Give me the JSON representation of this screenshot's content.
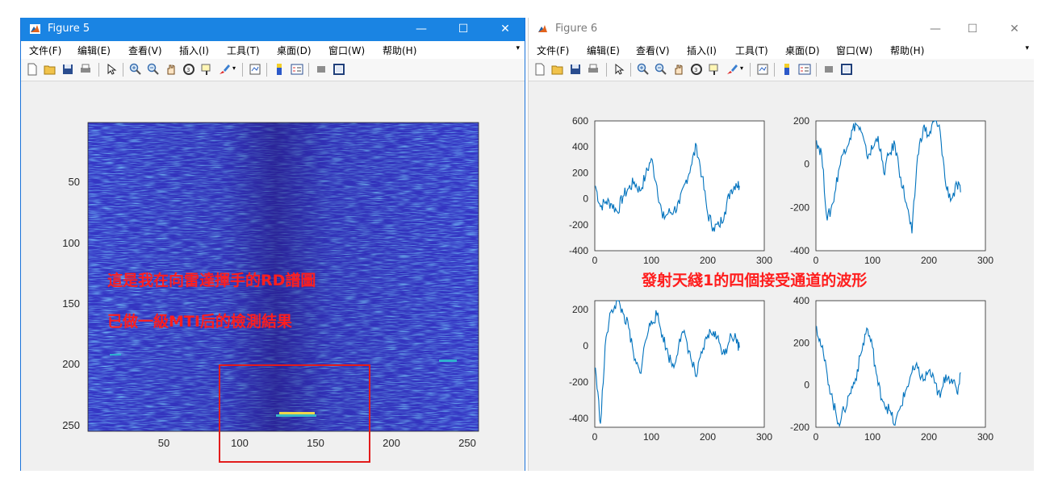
{
  "figure5": {
    "title": "Figure 5",
    "menus": [
      "文件(F)",
      "编辑(E)",
      "查看(V)",
      "插入(I)",
      "工具(T)",
      "桌面(D)",
      "窗口(W)",
      "帮助(H)"
    ],
    "controls": {
      "minimize": "—",
      "maximize": "☐",
      "close": "✕"
    },
    "annotation_line1": "這是我在向雷達揮手的RD譜圖",
    "annotation_line2": "已做一級MTI后的檢測結果",
    "plot": {
      "type": "heatmap",
      "xticks": [
        "50",
        "100",
        "150",
        "200",
        "250"
      ],
      "yticks": [
        "50",
        "100",
        "150",
        "200",
        "250"
      ],
      "xlim": [
        1,
        256
      ],
      "ylim": [
        1,
        256
      ]
    }
  },
  "figure6": {
    "title": "Figure 6",
    "menus": [
      "文件(F)",
      "编辑(E)",
      "查看(V)",
      "插入(I)",
      "工具(T)",
      "桌面(D)",
      "窗口(W)",
      "帮助(H)"
    ],
    "controls": {
      "minimize": "—",
      "maximize": "☐",
      "close": "✕"
    },
    "annotation": "發射天綫1的四個接受通道的波形"
  },
  "line_color": "#0072bd",
  "chart_data": [
    {
      "type": "line",
      "xlim": [
        0,
        300
      ],
      "ylim": [
        -400,
        600
      ],
      "xticks": [
        "0",
        "100",
        "200",
        "300"
      ],
      "yticks": [
        "600",
        "400",
        "200",
        "0",
        "-200",
        "-400"
      ],
      "x": [
        1,
        10,
        20,
        30,
        40,
        50,
        60,
        70,
        80,
        90,
        100,
        110,
        120,
        130,
        140,
        150,
        160,
        170,
        180,
        190,
        200,
        210,
        220,
        230,
        240,
        250,
        256
      ],
      "y": [
        100,
        -60,
        -20,
        -40,
        -100,
        20,
        80,
        130,
        60,
        180,
        310,
        100,
        -150,
        -110,
        -90,
        -40,
        120,
        250,
        410,
        170,
        -120,
        -220,
        -210,
        -100,
        60,
        120,
        100
      ]
    },
    {
      "type": "line",
      "xlim": [
        0,
        300
      ],
      "ylim": [
        -400,
        200
      ],
      "xticks": [
        "0",
        "100",
        "200",
        "300"
      ],
      "yticks": [
        "200",
        "0",
        "-200",
        "-400"
      ],
      "x": [
        1,
        10,
        20,
        30,
        40,
        50,
        60,
        70,
        80,
        90,
        100,
        110,
        120,
        130,
        140,
        150,
        160,
        170,
        180,
        190,
        200,
        210,
        220,
        230,
        240,
        250,
        256
      ],
      "y": [
        110,
        50,
        -260,
        -180,
        -30,
        70,
        120,
        190,
        150,
        40,
        70,
        130,
        -40,
        50,
        90,
        -60,
        -180,
        -320,
        40,
        170,
        130,
        200,
        150,
        -100,
        -160,
        -100,
        -130
      ]
    },
    {
      "type": "line",
      "xlim": [
        0,
        300
      ],
      "ylim": [
        -450,
        250
      ],
      "xticks": [
        "0",
        "100",
        "200",
        "300"
      ],
      "yticks": [
        "200",
        "0",
        "-200",
        "-400"
      ],
      "x": [
        1,
        10,
        20,
        30,
        40,
        50,
        60,
        70,
        80,
        90,
        100,
        110,
        120,
        130,
        140,
        150,
        160,
        170,
        180,
        190,
        200,
        210,
        220,
        230,
        240,
        250,
        256
      ],
      "y": [
        -120,
        -430,
        50,
        200,
        250,
        180,
        100,
        -80,
        -150,
        30,
        140,
        170,
        60,
        -50,
        -120,
        40,
        60,
        -70,
        -170,
        -40,
        60,
        80,
        20,
        -50,
        70,
        40,
        -10
      ]
    },
    {
      "type": "line",
      "xlim": [
        0,
        300
      ],
      "ylim": [
        -200,
        400
      ],
      "xticks": [
        "0",
        "100",
        "200",
        "300"
      ],
      "yticks": [
        "400",
        "200",
        "0",
        "-200"
      ],
      "x": [
        1,
        10,
        20,
        30,
        40,
        50,
        60,
        70,
        80,
        90,
        100,
        110,
        120,
        130,
        140,
        150,
        160,
        170,
        180,
        190,
        200,
        210,
        220,
        230,
        240,
        250,
        256
      ],
      "y": [
        280,
        180,
        50,
        -80,
        -180,
        -120,
        -40,
        30,
        150,
        270,
        180,
        0,
        -80,
        -120,
        -190,
        -100,
        -20,
        60,
        80,
        20,
        70,
        10,
        -60,
        50,
        30,
        -40,
        60
      ]
    }
  ]
}
